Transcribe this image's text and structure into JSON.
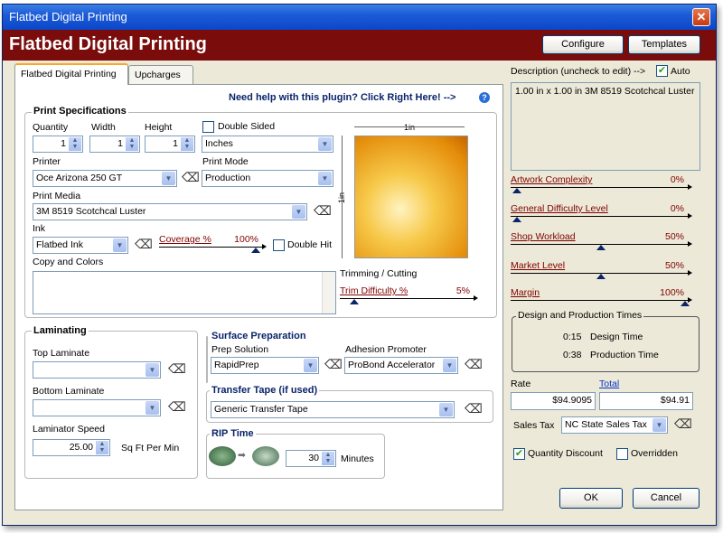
{
  "window": {
    "title": "Flatbed Digital Printing",
    "header": "Flatbed Digital Printing"
  },
  "toolbar": {
    "configure": "Configure",
    "templates": "Templates"
  },
  "tabs": [
    "Flatbed Digital Printing",
    "Upcharges"
  ],
  "help_link": "Need help with this plugin?  Click Right Here! -->",
  "print_specs": {
    "title": "Print Specifications",
    "quantity_label": "Quantity",
    "width_label": "Width",
    "height_label": "Height",
    "quantity": "1",
    "width": "1",
    "height": "1",
    "double_sided": "Double Sided",
    "units": "Inches",
    "printer_label": "Printer",
    "printer": "Oce Arizona 250 GT",
    "print_mode_label": "Print Mode",
    "print_mode": "Production",
    "media_label": "Print Media",
    "media": "3M 8519 Scotchcal Luster",
    "ink_label": "Ink",
    "ink": "Flatbed Ink",
    "coverage_label": "Coverage %",
    "coverage_value": "100%",
    "coverage_fraction": 0.95,
    "double_hit": "Double Hit",
    "copy_label": "Copy and Colors",
    "preview_width": "1in",
    "preview_height": "1in",
    "trimming_label": "Trimming / Cutting",
    "trim_label": "Trim Difficulty %",
    "trim_value": "5%",
    "trim_fraction": 0.05
  },
  "laminating": {
    "title": "Laminating",
    "top_label": "Top Laminate",
    "bottom_label": "Bottom Laminate",
    "speed_label": "Laminator Speed",
    "speed": "25.00",
    "speed_unit": "Sq Ft Per Min"
  },
  "surface": {
    "title": "Surface Preparation",
    "prep_label": "Prep Solution",
    "prep": "RapidPrep",
    "adhesion_label": "Adhesion Promoter",
    "adhesion": "ProBond Accelerator"
  },
  "transfer": {
    "title": "Transfer Tape (if used)",
    "value": "Generic Transfer Tape"
  },
  "rip": {
    "title": "RIP Time",
    "minutes": "30",
    "unit": "Minutes"
  },
  "right": {
    "description_label": "Description (uncheck to edit) -->",
    "auto": "Auto",
    "description": "1.00 in x 1.00 in 3M 8519 Scotchcal Luster",
    "sliders": [
      {
        "label": "Artwork Complexity",
        "value": "0%",
        "fraction": 0.0
      },
      {
        "label": "General Difficulty Level",
        "value": "0%",
        "fraction": 0.0
      },
      {
        "label": "Shop Workload",
        "value": "50%",
        "fraction": 0.5
      },
      {
        "label": "Market Level",
        "value": "50%",
        "fraction": 0.5
      },
      {
        "label": "Margin",
        "value": "100%",
        "fraction": 1.0
      }
    ],
    "times_title": "Design and Production Times",
    "design_time": "0:15",
    "design_label": "Design Time",
    "production_time": "0:38",
    "production_label": "Production Time",
    "rate_label": "Rate",
    "total_label": "Total",
    "rate": "$94.9095",
    "total": "$94.91",
    "sales_tax_label": "Sales Tax",
    "sales_tax": "NC State Sales Tax",
    "quantity_discount": "Quantity Discount",
    "overridden": "Overridden"
  },
  "footer": {
    "ok": "OK",
    "cancel": "Cancel"
  }
}
